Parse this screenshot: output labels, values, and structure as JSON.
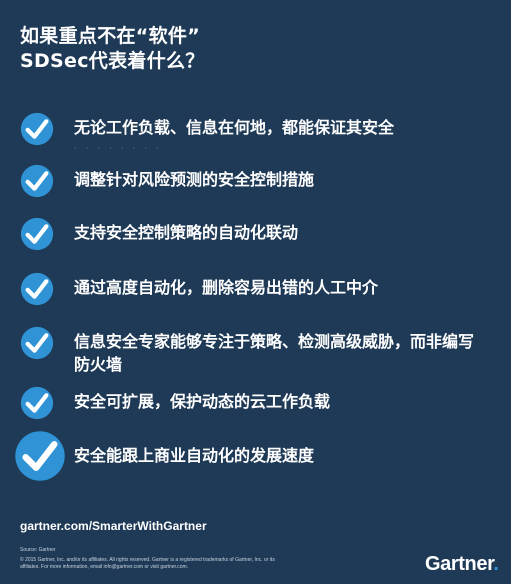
{
  "header": {
    "title_line1": "如果重点不在“软件”",
    "title_line2": "SDSec代表着什么？"
  },
  "items": [
    {
      "label": "无论工作负载、信息在何地，都能保证其安全"
    },
    {
      "label": "调整针对风险预测的安全控制措施"
    },
    {
      "label": "支持安全控制策略的自动化联动"
    },
    {
      "label": "通过高度自动化，删除容易出错的人工中介"
    },
    {
      "label": "信息安全专家能够专注于策略、检测高级威胁，而非编写防火墙"
    },
    {
      "label": "安全可扩展，保护动态的云工作负载"
    },
    {
      "label": "安全能跟上商业自动化的发展速度"
    }
  ],
  "decor": {
    "dots": "· · · · · · · ·"
  },
  "footer": {
    "url": "gartner.com/SmarterWithGartner",
    "source": "Source: Gartner",
    "copyright": "© 2015 Gartner, Inc. and/or its affiliates. All rights reserved. Gartner is a registered trademarks of Gartner, Inc. or its affiliates. For more information, email info@gartner.com or visit gartner.com.",
    "logo": "Gartner",
    "logo_dot": "."
  },
  "colors": {
    "background": "#1f3a57",
    "check_fill": "#2f93d6",
    "text": "#ffffff"
  },
  "icons": {
    "check": "check-circle-icon"
  }
}
